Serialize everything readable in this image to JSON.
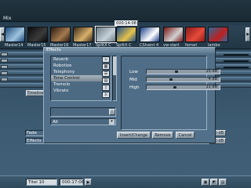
{
  "app": {
    "mode_label": "Mix"
  },
  "timecode_top": "000:14:08",
  "storyboard": {
    "thumbs": [
      {
        "label": "Master14",
        "color1": "#1b4a7a",
        "color2": "#9fc3e0"
      },
      {
        "label": "Master15",
        "color1": "#0c0c0c",
        "color2": "#3b3b3b"
      },
      {
        "label": "Master16",
        "color1": "#2a1a12",
        "color2": "#a47a4f"
      },
      {
        "label": "Master17",
        "color1": "#3a2a1a",
        "color2": "#d8b06a"
      },
      {
        "label": "SplitX C",
        "color1": "#6c7b86",
        "color2": "#c6d1d8"
      },
      {
        "label": "SplitX C",
        "color1": "#1e4f8a",
        "color2": "#e6c24a"
      },
      {
        "label": "CShaint 4",
        "color1": "#1a3e8a",
        "color2": "#ffffff"
      },
      {
        "label": "vw-start",
        "color1": "#7a1616",
        "color2": "#d0d0d0"
      },
      {
        "label": "ferrari",
        "color1": "#8a1a1a",
        "color2": "#e64a3a"
      },
      {
        "label": "lambo",
        "color1": "#2a6a9a",
        "color2": "#c02020"
      }
    ]
  },
  "timeline_label": "Timeline",
  "effects_window": {
    "title": "Effects",
    "items": [
      "Reverb",
      "Robotize",
      "Telephony",
      "Tone Control",
      "Tremolo",
      "Vibrato"
    ],
    "selected_index": 3,
    "icons": [
      "waveform-icon",
      "grid-icon",
      "sliders-icon",
      "tone-icon",
      "page-icon",
      "person-icon"
    ],
    "icon_glyphs": [
      "≈",
      "▦",
      "☰",
      "▤",
      "▯",
      "♙"
    ],
    "category_value": "All",
    "sliders": [
      {
        "label": "Low",
        "value": "15 dB",
        "level": 0.52
      },
      {
        "label": "Mid",
        "value": "4 dB",
        "level": 0.42
      },
      {
        "label": "High",
        "value": "11 dB",
        "level": 0.48
      }
    ],
    "buttons": {
      "insert": "Insert/Change",
      "remove": "Remove",
      "cancel": "Cancel"
    }
  },
  "tracks_bottom": [
    {
      "label": "Fade",
      "value": "0 dB"
    },
    {
      "label": "Effects",
      "value": "0 dB"
    }
  ],
  "footer": {
    "title_label": "Titel 10",
    "timecode": "000:17:06",
    "play_glyph": "▶"
  }
}
